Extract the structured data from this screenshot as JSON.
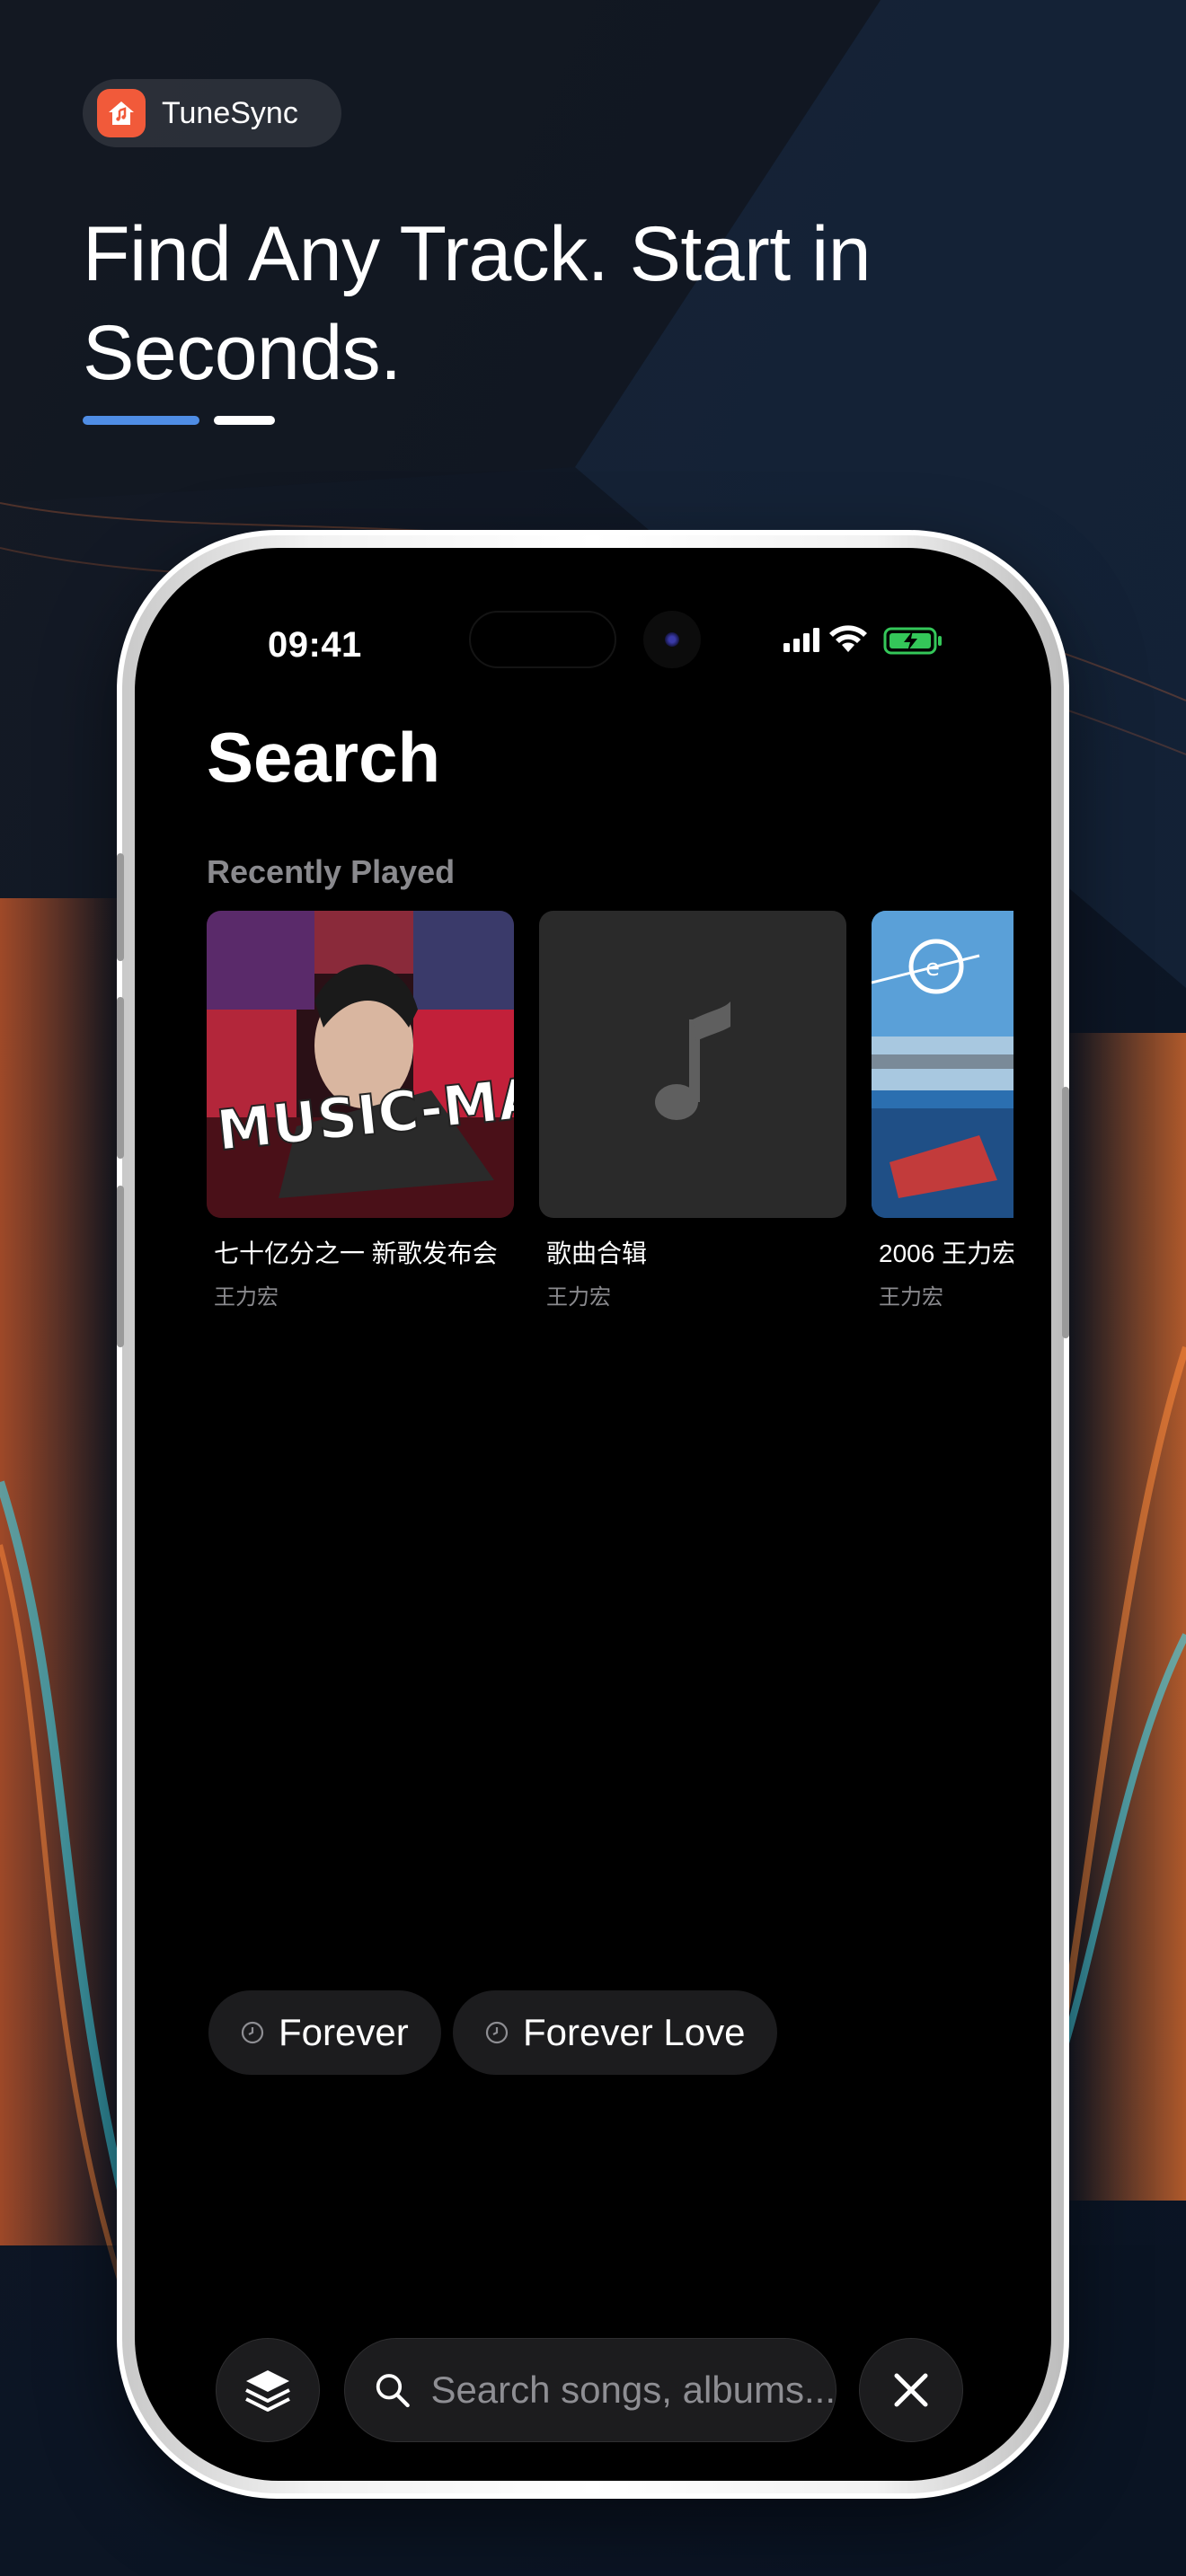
{
  "app": {
    "name": "TuneSync",
    "icon": "app-logo-icon",
    "headline": "Find Any Track. Start in Seconds."
  },
  "status_bar": {
    "time": "09:41",
    "icons": [
      "cellular-signal-icon",
      "wifi-icon",
      "battery-charging-icon"
    ]
  },
  "screen": {
    "title": "Search",
    "recent_section_label": "Recently Played",
    "recent_albums": [
      {
        "title": "七十亿分之一 新歌发布会",
        "artist": "王力宏",
        "cover": "album-cover-art"
      },
      {
        "title": "歌曲合辑",
        "artist": "王力宏",
        "cover": "music-note-placeholder"
      },
      {
        "title": "2006 王力宏",
        "artist": "王力宏",
        "cover": "album-cover-art"
      }
    ],
    "recent_searches": [
      {
        "label": "Forever",
        "icon": "clock-icon"
      },
      {
        "label": "Forever Love",
        "icon": "clock-icon"
      }
    ],
    "bottom_bar": {
      "layers_button_icon": "layers-icon",
      "search_icon": "search-icon",
      "search_placeholder": "Search songs, albums...",
      "close_button_icon": "close-icon"
    }
  },
  "colors": {
    "accent_bar": "#4f8de5",
    "brand_logo": "#f15a3a",
    "screen_background": "#000000",
    "chip_background": "#1c1c1e",
    "battery_green": "#34c759"
  }
}
